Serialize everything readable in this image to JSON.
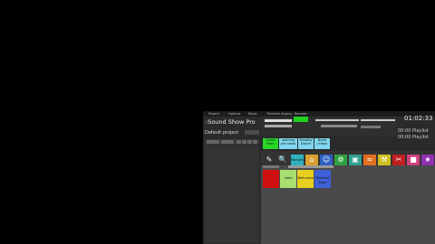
{
  "app": {
    "title": ":Sound Show Pro",
    "project_name": "Default project",
    "menu": [
      "Project",
      "Options",
      "Music",
      "Timeline display",
      "Remote"
    ],
    "clock": "01:02:33",
    "elapsed_1": "00:00",
    "elapsed_2": "00:00",
    "track_label_1": "Playlist",
    "track_label_2": "Playlist"
  },
  "cue_tiles": [
    {
      "label": "Check Mom",
      "color": "#27d827"
    },
    {
      "label": "opening pre show",
      "color": "#7fd8ef"
    },
    {
      "label": "Tuesday Dance",
      "color": "#7fd8ef"
    },
    {
      "label": "Night crowd",
      "color": "#7fd8ef"
    }
  ],
  "tool_icons": [
    {
      "name": "pen-icon",
      "glyph": "✎"
    },
    {
      "name": "search-icon",
      "glyph": "🔍"
    }
  ],
  "category_tiles": [
    {
      "label": "Remarks",
      "color": "#2fb0c0"
    },
    {
      "name": "house-icon",
      "glyph": "⌂",
      "color": "#d8a030"
    },
    {
      "name": "person-icon",
      "glyph": "☺",
      "color": "#3060c0"
    },
    {
      "name": "gear-icon",
      "glyph": "⚙",
      "color": "#30a040"
    },
    {
      "name": "screen-icon",
      "glyph": "▣",
      "color": "#2fa090"
    },
    {
      "name": "wave-icon",
      "glyph": "≈",
      "color": "#e07020"
    },
    {
      "name": "hammer-icon",
      "glyph": "⚒",
      "color": "#d0c020"
    },
    {
      "name": "wrench-icon",
      "glyph": "✂",
      "color": "#c02020"
    },
    {
      "name": "tag-icon",
      "glyph": "■",
      "color": "#d04080"
    },
    {
      "name": "star-icon",
      "glyph": "★",
      "color": "#9030b0"
    }
  ],
  "carts": [
    {
      "label": "",
      "color": "#d01010"
    },
    {
      "label": "Lake",
      "color": "#a8e070"
    },
    {
      "label": "Welcome",
      "color": "#e8d020"
    },
    {
      "label": "Moment Now",
      "color": "#4060d8"
    }
  ]
}
